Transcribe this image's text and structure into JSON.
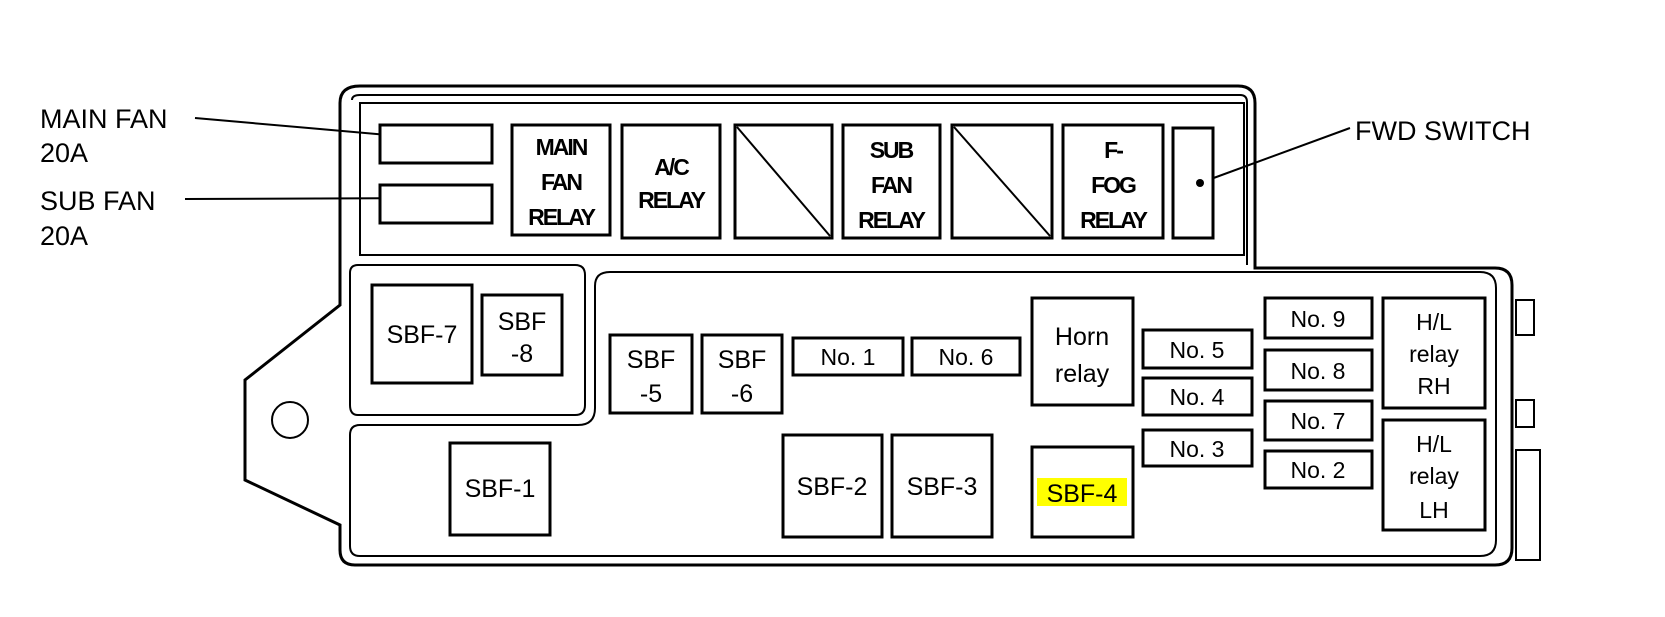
{
  "callouts": {
    "main_fan": [
      "MAIN FAN",
      "20A"
    ],
    "sub_fan": [
      "SUB FAN",
      "20A"
    ],
    "fwd_switch": "FWD SWITCH"
  },
  "top_row": {
    "main_fan_relay": [
      "MAIN",
      "FAN",
      "RELAY"
    ],
    "ac_relay": [
      "A/C",
      "RELAY"
    ],
    "sub_fan_relay": [
      "SUB",
      "FAN",
      "RELAY"
    ],
    "f_fog_relay": [
      "F-",
      "FOG",
      "RELAY"
    ]
  },
  "fuses": {
    "sbf7": "SBF-7",
    "sbf8": [
      "SBF",
      "-8"
    ],
    "sbf5": [
      "SBF",
      "-5"
    ],
    "sbf6": [
      "SBF",
      "-6"
    ],
    "no1": "No. 1",
    "no6": "No. 6",
    "no5": "No. 5",
    "no4": "No. 4",
    "no3": "No. 3",
    "no9": "No. 9",
    "no8": "No. 8",
    "no7": "No. 7",
    "no2": "No. 2",
    "sbf1": "SBF-1",
    "sbf2": "SBF-2",
    "sbf3": "SBF-3",
    "sbf4": "SBF-4"
  },
  "relays": {
    "horn": [
      "Horn",
      "relay"
    ],
    "hl_rh": [
      "H/L",
      "relay",
      "RH"
    ],
    "hl_lh": [
      "H/L",
      "relay",
      "LH"
    ]
  },
  "colors": {
    "highlight": "#ffff00",
    "line": "#000000"
  },
  "highlighted_item": "SBF-4"
}
